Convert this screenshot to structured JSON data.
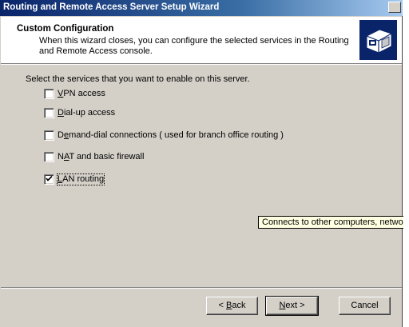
{
  "window": {
    "title": "Routing and Remote Access Server Setup Wizard"
  },
  "header": {
    "title": "Custom Configuration",
    "description": "When this wizard closes, you can configure the selected services in the Routing and Remote Access console."
  },
  "main": {
    "prompt": "Select the services that you want to enable on this server.",
    "options": [
      {
        "label": "VPN access",
        "checked": false,
        "accel": "V",
        "rest": "PN access"
      },
      {
        "label": "Dial-up access",
        "checked": false,
        "accel": "D",
        "rest": "ial-up access"
      },
      {
        "label": "Demand-dial connections ( used for branch office routing )",
        "checked": false,
        "pre": "D",
        "accel": "e",
        "rest": "mand-dial connections ( used for branch office routing )"
      },
      {
        "label": "NAT and basic firewall",
        "checked": false,
        "pre": "N",
        "accel": "A",
        "rest": "T and basic firewall"
      },
      {
        "label": "LAN routing",
        "checked": true,
        "accel": "L",
        "rest": "AN routing"
      }
    ]
  },
  "tooltip": "Connects to other computers, network",
  "buttons": {
    "back": {
      "label": "< Back",
      "pre": "< ",
      "accel": "B",
      "rest": "ack"
    },
    "next": {
      "label": "Next >",
      "accel": "N",
      "rest": "ext >"
    },
    "cancel": {
      "label": "Cancel"
    }
  }
}
